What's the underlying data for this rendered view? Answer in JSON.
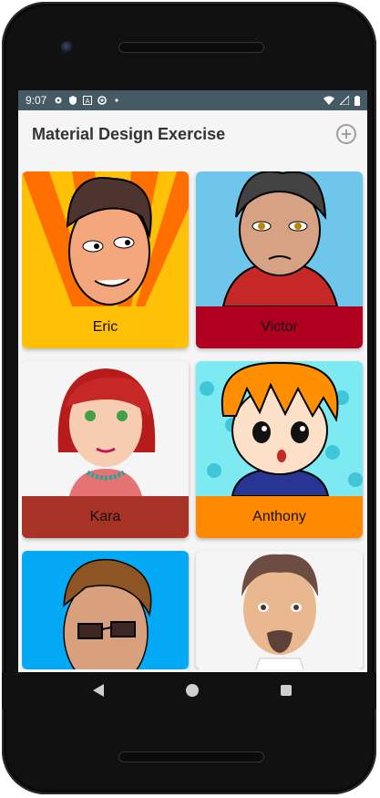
{
  "status_bar": {
    "time": "9:07",
    "icons": [
      "gear-icon",
      "shield-icon",
      "a-icon",
      "circle-icon",
      "dot-icon"
    ],
    "right_icons": [
      "wifi-icon",
      "signal-icon",
      "battery-icon"
    ]
  },
  "app_bar": {
    "title": "Material Design Exercise",
    "action_icon": "add-circle-icon"
  },
  "cards": [
    {
      "name": "Eric",
      "label_color": "#ffc107"
    },
    {
      "name": "Victor",
      "label_color": "#b00020"
    },
    {
      "name": "Kara",
      "label_color": "#a93226"
    },
    {
      "name": "Anthony",
      "label_color": "#ff8a00"
    },
    {
      "name": "",
      "label_color": "#03a9f4"
    },
    {
      "name": "",
      "label_color": "#f5f5f5"
    }
  ],
  "nav_bar": {
    "icons": [
      "back-icon",
      "home-icon",
      "recents-icon"
    ]
  }
}
